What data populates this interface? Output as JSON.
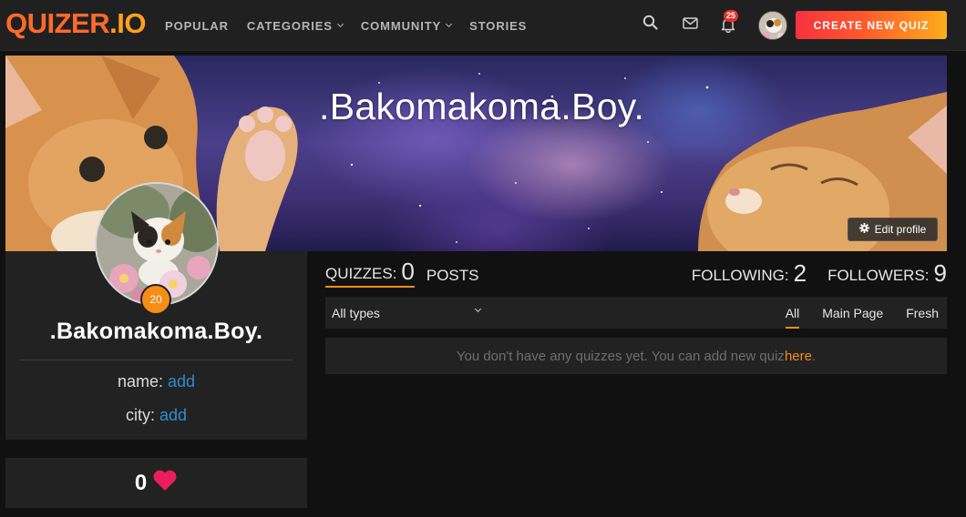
{
  "brand": {
    "part1": "QUIZER",
    "part2": ".IO"
  },
  "nav": {
    "links": [
      "POPULAR",
      "CATEGORIES",
      "COMMUNITY",
      "STORIES"
    ],
    "notifications_count": "25",
    "create_button": "CREATE NEW QUIZ"
  },
  "icons": {
    "search": "search-icon",
    "mail": "mail-icon",
    "bell": "bell-icon",
    "gear": "gear-icon",
    "heart": "heart-icon",
    "caret": "chevron-down-icon"
  },
  "colors": {
    "accent": "#f58d16",
    "link": "#2d8cd2",
    "heart": "#ea1e5e",
    "badge": "#e8312a"
  },
  "banner": {
    "title": ".Bakomakoma.Boy.",
    "edit_button": "Edit profile"
  },
  "profile": {
    "name": ".Bakomakoma.Boy.",
    "level": "20",
    "name_label": "name:",
    "name_value": "add",
    "city_label": "city:",
    "city_value": "add",
    "likes": "0"
  },
  "tabs": {
    "quizzes_label": "QUIZZES:",
    "quizzes_count": "0",
    "posts_label": "POSTS",
    "following_label": "FOLLOWING:",
    "following_count": "2",
    "followers_label": "FOLLOWERS:",
    "followers_count": "9"
  },
  "filter": {
    "type_selected": "All types",
    "tabs": [
      "All",
      "Main Page",
      "Fresh"
    ]
  },
  "empty": {
    "message": "You don't have any quizzes yet. You can add new quiz ",
    "link": "here",
    "period": "."
  }
}
